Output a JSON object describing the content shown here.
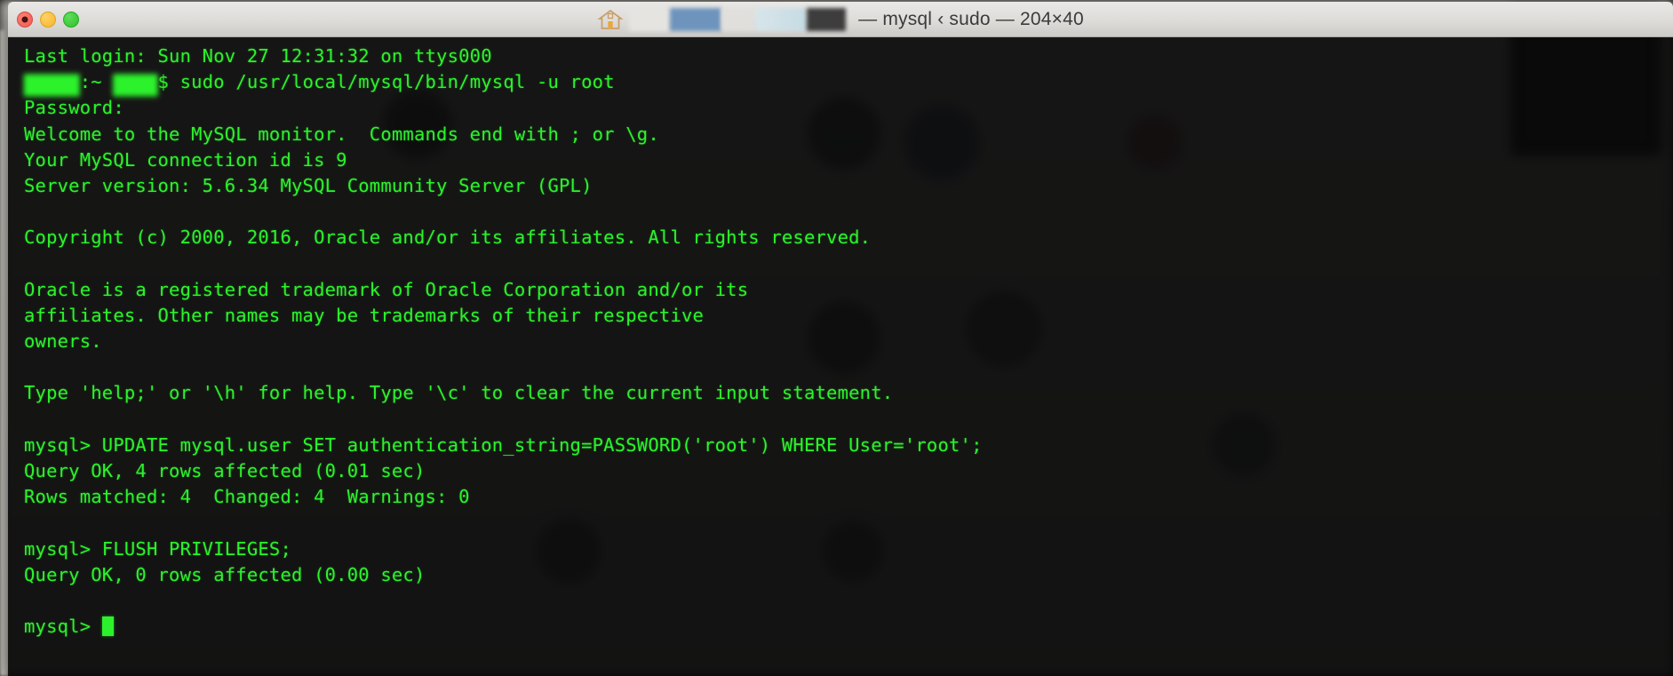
{
  "window": {
    "title": "— mysql ‹ sudo — 204×40",
    "traffic_lights": [
      {
        "name": "close",
        "color": "#f1594f"
      },
      {
        "name": "minimize",
        "color": "#f5b527"
      },
      {
        "name": "maximize",
        "color": "#2cc22c"
      }
    ],
    "titlebar_icon": "home-icon"
  },
  "terminal": {
    "foreground_color": "#2cf22c",
    "background_color": "#080808",
    "lines": [
      {
        "id": "l01",
        "text": "Last login: Sun Nov 27 12:31:32 on ttys000"
      },
      {
        "id": "l02",
        "text": ":~ $ sudo /usr/local/mysql/bin/mysql -u root",
        "redacted": true
      },
      {
        "id": "l03",
        "text": "Password:"
      },
      {
        "id": "l04",
        "text": "Welcome to the MySQL monitor.  Commands end with ; or \\g."
      },
      {
        "id": "l05",
        "text": "Your MySQL connection id is 9"
      },
      {
        "id": "l06",
        "text": "Server version: 5.6.34 MySQL Community Server (GPL)"
      },
      {
        "id": "l07",
        "text": ""
      },
      {
        "id": "l08",
        "text": "Copyright (c) 2000, 2016, Oracle and/or its affiliates. All rights reserved."
      },
      {
        "id": "l09",
        "text": ""
      },
      {
        "id": "l10",
        "text": "Oracle is a registered trademark of Oracle Corporation and/or its"
      },
      {
        "id": "l11",
        "text": "affiliates. Other names may be trademarks of their respective"
      },
      {
        "id": "l12",
        "text": "owners."
      },
      {
        "id": "l13",
        "text": ""
      },
      {
        "id": "l14",
        "text": "Type 'help;' or '\\h' for help. Type '\\c' to clear the current input statement."
      },
      {
        "id": "l15",
        "text": ""
      },
      {
        "id": "l16",
        "text": "mysql> UPDATE mysql.user SET authentication_string=PASSWORD('root') WHERE User='root';"
      },
      {
        "id": "l17",
        "text": "Query OK, 4 rows affected (0.01 sec)"
      },
      {
        "id": "l18",
        "text": "Rows matched: 4  Changed: 4  Warnings: 0"
      },
      {
        "id": "l19",
        "text": ""
      },
      {
        "id": "l20",
        "text": "mysql> FLUSH PRIVILEGES;"
      },
      {
        "id": "l21",
        "text": "Query OK, 0 rows affected (0.00 sec)"
      },
      {
        "id": "l22",
        "text": ""
      },
      {
        "id": "l23",
        "text": "mysql> ",
        "cursor": true
      }
    ],
    "redacted_prompt": {
      "prefix_masked": "█████",
      "host_suffix": ":~ ",
      "user_masked": "████",
      "symbol": "$",
      "command": " sudo /usr/local/mysql/bin/mysql -u root"
    }
  }
}
